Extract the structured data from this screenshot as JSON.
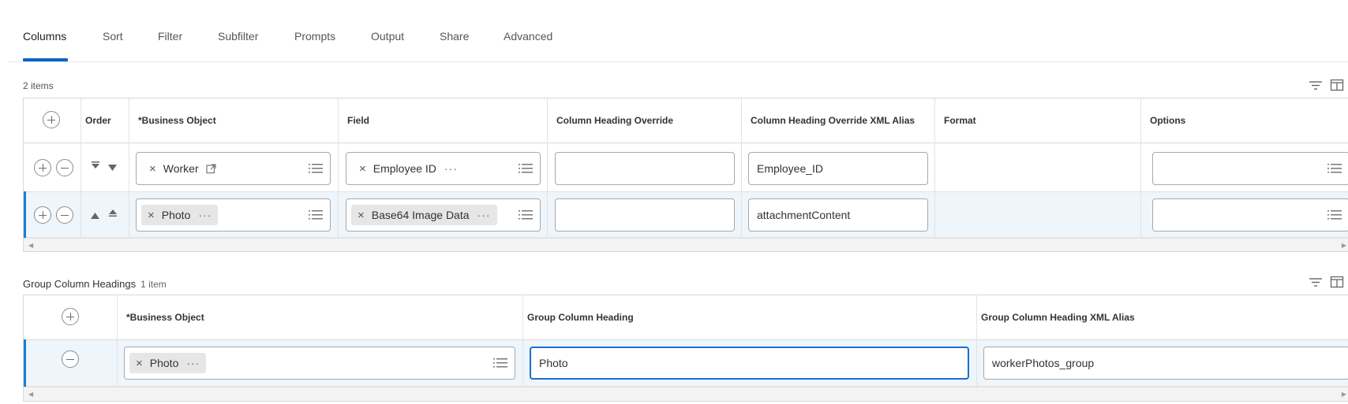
{
  "tabs": [
    {
      "label": "Columns",
      "active": true
    },
    {
      "label": "Sort"
    },
    {
      "label": "Filter"
    },
    {
      "label": "Subfilter"
    },
    {
      "label": "Prompts"
    },
    {
      "label": "Output"
    },
    {
      "label": "Share"
    },
    {
      "label": "Advanced"
    }
  ],
  "columns_table": {
    "count_label": "2 items",
    "headers": {
      "order": "Order",
      "business_object": "*Business Object",
      "field": "Field",
      "heading_override": "Column Heading Override",
      "xml_alias": "Column Heading Override XML Alias",
      "format": "Format",
      "options": "Options"
    },
    "rows": [
      {
        "business_object": "Worker",
        "field": "Employee ID",
        "heading_override": "",
        "xml_alias": "Employee_ID",
        "format": "",
        "options": ""
      },
      {
        "business_object": "Photo",
        "field": "Base64 Image Data",
        "heading_override": "",
        "xml_alias": "attachmentContent",
        "format": "",
        "options": "",
        "selected": true
      }
    ]
  },
  "group_table": {
    "title": "Group Column Headings",
    "count_label": "1 item",
    "headers": {
      "business_object": "*Business Object",
      "group_heading": "Group Column Heading",
      "group_xml_alias": "Group Column Heading XML Alias"
    },
    "rows": [
      {
        "business_object": "Photo",
        "group_heading": "Photo",
        "group_xml_alias": "workerPhotos_group",
        "selected": true
      }
    ]
  },
  "icons": {
    "remove": "×",
    "more": "···"
  },
  "colors": {
    "accent": "#0b64c7",
    "selected_row": "#eef5fb",
    "selected_bar": "#1a7fd8"
  }
}
